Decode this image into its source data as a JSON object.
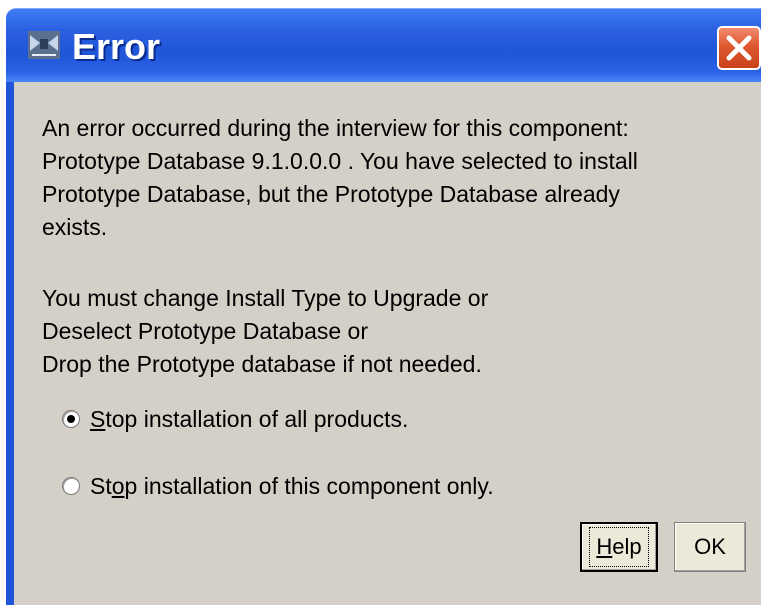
{
  "window": {
    "title": "Error",
    "icon": "java-cup-icon",
    "close_icon": "close-x-icon"
  },
  "message": {
    "lines": [
      "An error occurred during the interview for this component:",
      "Prototype Database 9.1.0.0.0 . You have selected to install",
      "Prototype Database, but the Prototype Database already",
      "exists.",
      "You must change Install Type to Upgrade or",
      "Deselect Prototype Database or",
      "Drop the Prototype database if not needed."
    ]
  },
  "options": [
    {
      "mnemonic": "S",
      "rest": "top installation of all products.",
      "selected": true
    },
    {
      "pre": "St",
      "mnemonic": "o",
      "rest": "p installation of this component only.",
      "selected": false
    }
  ],
  "buttons": {
    "help": {
      "mnemonic": "H",
      "rest": "elp"
    },
    "ok": {
      "label": "OK"
    }
  },
  "colors": {
    "titlebar": "#2a5fe0",
    "close": "#e0582e",
    "body": "#d4d0c8"
  }
}
